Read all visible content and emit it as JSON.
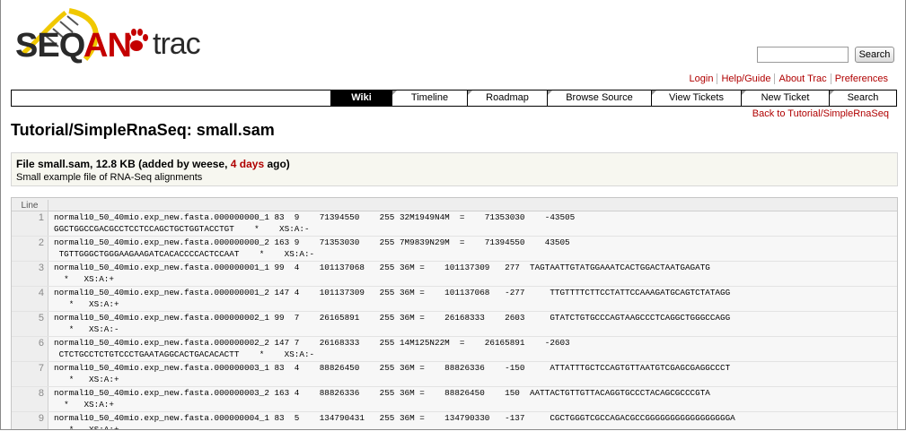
{
  "logo": {
    "parts": [
      "SEQ",
      "AN",
      "trac"
    ]
  },
  "search": {
    "button_label": "Search",
    "value": ""
  },
  "metanav": [
    "Login",
    "Help/Guide",
    "About Trac",
    "Preferences"
  ],
  "mainnav": [
    {
      "label": "Wiki",
      "active": true
    },
    {
      "label": "Timeline"
    },
    {
      "label": "Roadmap"
    },
    {
      "label": "Browse Source"
    },
    {
      "label": "View Tickets"
    },
    {
      "label": "New Ticket"
    },
    {
      "label": "Search"
    }
  ],
  "back_link": "Back to Tutorial/SimpleRnaSeq",
  "page_title": "Tutorial/SimpleRnaSeq: small.sam",
  "fileinfo": {
    "prefix": "File small.sam, 12.8 KB (added by weese, ",
    "age": "4 days",
    "suffix": " ago)",
    "description": "Small example file of RNA-Seq alignments"
  },
  "code": {
    "line_header": "Line",
    "lines": [
      {
        "n": "1",
        "a": "normal10_50_40mio.exp_new.fasta.000000000_1 83  9    71394550    255 32M1949N4M  =    71353030    -43505",
        "b": "GGCTGGCCGACGCCTCCTCCAGCTGCTGGTACCTGT    *    XS:A:-"
      },
      {
        "n": "2",
        "a": "normal10_50_40mio.exp_new.fasta.000000000_2 163 9    71353030    255 7M9839N29M  =    71394550    43505",
        "b": " TGTTGGGCTGGGAAGAAGATCACACCCCACTCCAAT    *    XS:A:-"
      },
      {
        "n": "3",
        "a": "normal10_50_40mio.exp_new.fasta.000000001_1 99  4    101137068   255 36M =    101137309   277  TAGTAATTGTATGGAAATCACTGGACTAATGAGATG",
        "b": "  *   XS:A:+"
      },
      {
        "n": "4",
        "a": "normal10_50_40mio.exp_new.fasta.000000001_2 147 4    101137309   255 36M =    101137068   -277     TTGTTTTCTTCCTATTCCAAAGATGCAGTCTATAGG",
        "b": "   *   XS:A:+"
      },
      {
        "n": "5",
        "a": "normal10_50_40mio.exp_new.fasta.000000002_1 99  7    26165891    255 36M =    26168333    2603     GTATCTGTGCCCAGTAAGCCCTCAGGCTGGGCCAGG",
        "b": "   *   XS:A:-"
      },
      {
        "n": "6",
        "a": "normal10_50_40mio.exp_new.fasta.000000002_2 147 7    26168333    255 14M125N22M  =    26165891    -2603",
        "b": " CTCTGCCTCTGTCCCTGAATAGGCACTGACACACTT    *    XS:A:-"
      },
      {
        "n": "7",
        "a": "normal10_50_40mio.exp_new.fasta.000000003_1 83  4    88826450    255 36M =    88826336    -150     ATTATTTGCTCCAGTGTTAATGTCGAGCGAGGCCCT",
        "b": "   *   XS:A:+"
      },
      {
        "n": "8",
        "a": "normal10_50_40mio.exp_new.fasta.000000003_2 163 4    88826336    255 36M =    88826450    150  AATTACTGTTGTTACAGGTGCCCTACAGCGCCCGTA",
        "b": "  *   XS:A:+"
      },
      {
        "n": "9",
        "a": "normal10_50_40mio.exp_new.fasta.000000004_1 83  5    134790431   255 36M =    134790330   -137     CGCTGGGTCGCCAGACGCCGGGGGGGGGGGGGGGGGA",
        "b": "   *   XS:A:+"
      }
    ]
  }
}
